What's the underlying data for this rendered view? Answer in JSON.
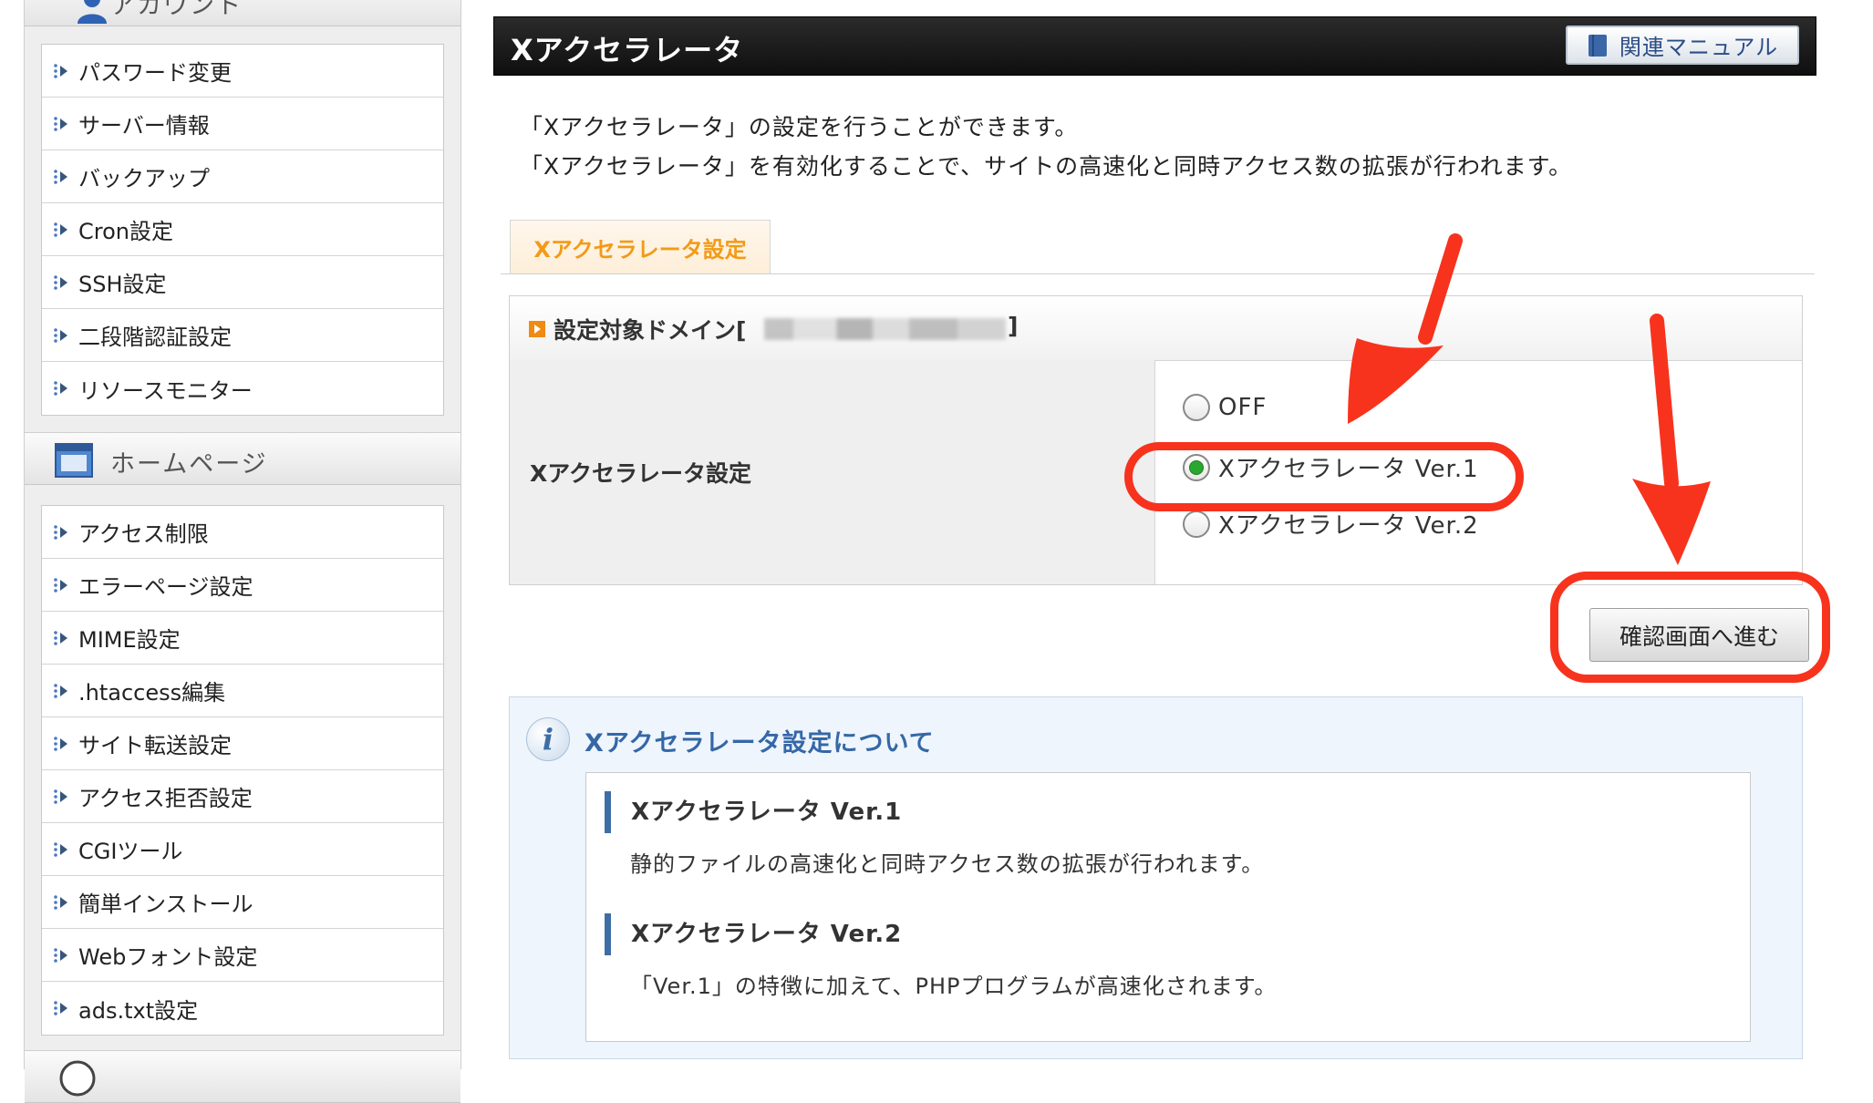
{
  "sidebar": {
    "account_title": "アカウント",
    "account_items": [
      {
        "label": "パスワード変更"
      },
      {
        "label": "サーバー情報"
      },
      {
        "label": "バックアップ"
      },
      {
        "label": "Cron設定"
      },
      {
        "label": "SSH設定"
      },
      {
        "label": "二段階認証設定"
      },
      {
        "label": "リソースモニター"
      }
    ],
    "homepage_title": "ホームページ",
    "homepage_items": [
      {
        "label": "アクセス制限"
      },
      {
        "label": "エラーページ設定"
      },
      {
        "label": "MIME設定"
      },
      {
        "label": ".htaccess編集"
      },
      {
        "label": "サイト転送設定"
      },
      {
        "label": "アクセス拒否設定"
      },
      {
        "label": "CGIツール"
      },
      {
        "label": "簡単インストール"
      },
      {
        "label": "Webフォント設定"
      },
      {
        "label": "ads.txt設定"
      }
    ]
  },
  "header": {
    "title": "Xアクセラレータ",
    "manual_label": "関連マニュアル"
  },
  "intro": {
    "line1": "「Xアクセラレータ」の設定を行うことができます。",
    "line2": "「Xアクセラレータ」を有効化することで、サイトの高速化と同時アクセス数の拡張が行われます。"
  },
  "tab": {
    "label": "Xアクセラレータ設定"
  },
  "settings": {
    "domain_label": "設定対象ドメイン[",
    "domain_close": "]",
    "row_label": "Xアクセラレータ設定",
    "options": [
      {
        "label": "OFF",
        "checked": false
      },
      {
        "label": "Xアクセラレータ Ver.1",
        "checked": true
      },
      {
        "label": "Xアクセラレータ Ver.2",
        "checked": false
      }
    ],
    "confirm_label": "確認画面へ進む"
  },
  "info": {
    "title": "Xアクセラレータ設定について",
    "v1_heading": "Xアクセラレータ Ver.1",
    "v1_text": "静的ファイルの高速化と同時アクセス数の拡張が行われます。",
    "v2_heading": "Xアクセラレータ Ver.2",
    "v2_text": "「Ver.1」の特徴に加えて、PHPプログラムが高速化されます。"
  },
  "colors": {
    "annotation": "#f7331d",
    "tab_text": "#f39a17",
    "link_blue": "#3567a7",
    "radio_checked": "#29a82f"
  }
}
